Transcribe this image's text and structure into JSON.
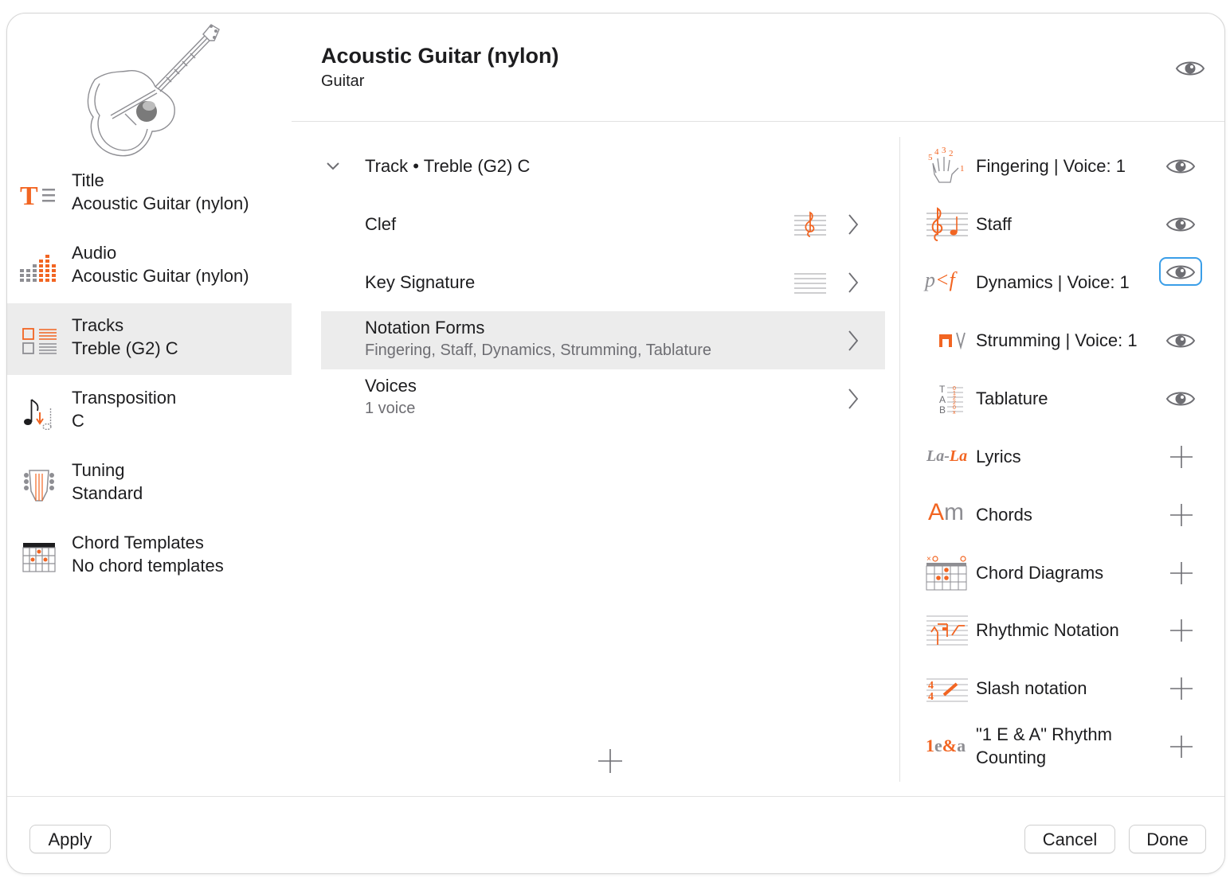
{
  "colors": {
    "accent": "#f26522",
    "focus_ring": "#3a9ee8",
    "selected_bg": "#ececec"
  },
  "header": {
    "title": "Acoustic Guitar (nylon)",
    "subtitle": "Guitar",
    "visibility_icon": "eye-icon"
  },
  "sidebar": {
    "items": [
      {
        "name": "Title",
        "value": "Acoustic Guitar (nylon)",
        "icon": "title-icon"
      },
      {
        "name": "Audio",
        "value": "Acoustic Guitar (nylon)",
        "icon": "audio-meter-icon"
      },
      {
        "name": "Tracks",
        "value": "Treble (G2) C",
        "icon": "tracks-icon",
        "selected": true
      },
      {
        "name": "Transposition",
        "value": "C",
        "icon": "transposition-icon"
      },
      {
        "name": "Tuning",
        "value": "Standard",
        "icon": "tuning-headstock-icon"
      },
      {
        "name": "Chord Templates",
        "value": "No chord templates",
        "icon": "chord-grid-icon"
      }
    ]
  },
  "middle": {
    "track_header": "Track • Treble (G2) C",
    "rows": [
      {
        "label": "Clef"
      },
      {
        "label": "Key Signature"
      },
      {
        "label": "Notation Forms",
        "sub": "Fingering, Staff, Dynamics, Strumming, Tablature",
        "selected": true
      },
      {
        "label": "Voices",
        "sub": "1 voice"
      }
    ]
  },
  "notation_forms": {
    "items": [
      {
        "label": "Fingering | Voice: 1",
        "icon": "fingering-hand-icon",
        "state": "visible"
      },
      {
        "label": "Staff",
        "icon": "staff-icon",
        "state": "visible"
      },
      {
        "label": "Dynamics | Voice: 1",
        "icon": "dynamics-icon",
        "icon_text": "p<f",
        "state": "visible",
        "focused": true
      },
      {
        "label": "Strumming | Voice: 1",
        "icon": "strumming-icon",
        "state": "visible"
      },
      {
        "label": "Tablature",
        "icon": "tablature-icon",
        "state": "visible"
      },
      {
        "label": "Lyrics",
        "icon": "lyrics-icon",
        "icon_text": "La-La",
        "state": "add"
      },
      {
        "label": "Chords",
        "icon": "chords-icon",
        "icon_text": "Am",
        "state": "add"
      },
      {
        "label": "Chord Diagrams",
        "icon": "chord-diagram-icon",
        "state": "add"
      },
      {
        "label": "Rhythmic Notation",
        "icon": "rhythmic-notation-icon",
        "state": "add"
      },
      {
        "label": "Slash notation",
        "icon": "slash-notation-icon",
        "state": "add"
      },
      {
        "label": "\"1 E & A\" Rhythm Counting",
        "label_lines": [
          "\"1 E & A\" Rhythm",
          "Counting"
        ],
        "icon": "rhythm-counting-icon",
        "icon_text": "1e&a",
        "state": "add"
      }
    ]
  },
  "footer": {
    "apply": "Apply",
    "cancel": "Cancel",
    "done": "Done"
  }
}
